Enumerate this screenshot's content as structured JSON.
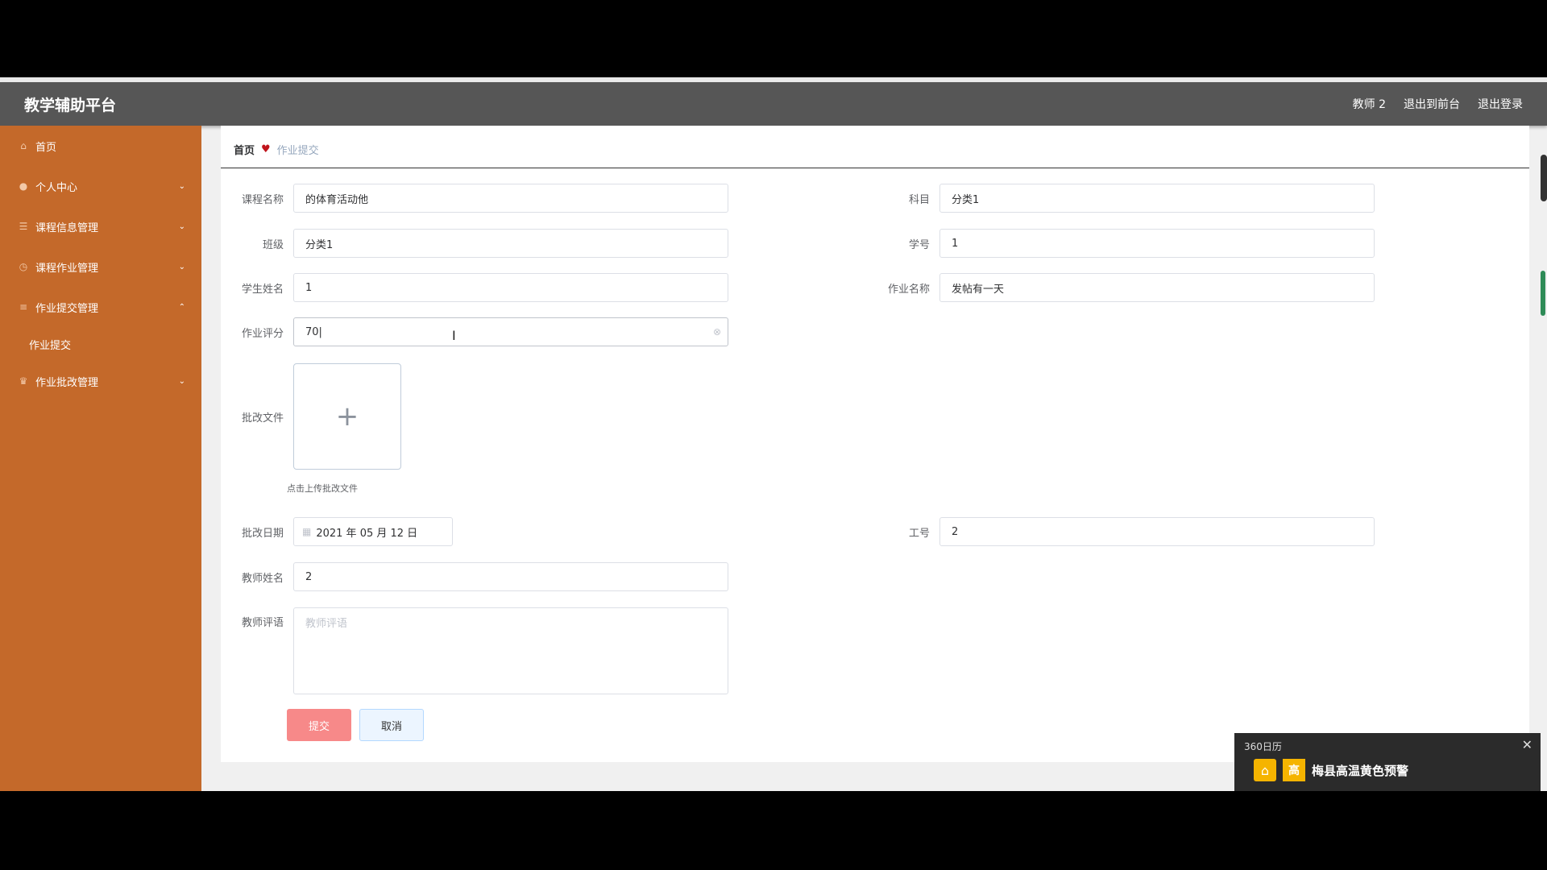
{
  "header": {
    "app_title": "教学辅助平台",
    "user": "教师 2",
    "back_frontend": "退出到前台",
    "logout": "退出登录"
  },
  "sidebar": {
    "items": [
      {
        "label": "首页",
        "icon": "home-icon"
      },
      {
        "label": "个人中心",
        "icon": "user-icon"
      },
      {
        "label": "课程信息管理",
        "icon": "list-icon"
      },
      {
        "label": "课程作业管理",
        "icon": "clock-icon"
      },
      {
        "label": "作业提交管理",
        "icon": "menu-icon"
      },
      {
        "label": "作业批改管理",
        "icon": "trophy-icon"
      }
    ],
    "sub_item": "作业提交"
  },
  "breadcrumb": {
    "home": "首页",
    "current": "作业提交"
  },
  "form": {
    "course_name": {
      "label": "课程名称",
      "value": "的体育活动他"
    },
    "subject": {
      "label": "科目",
      "value": "分类1"
    },
    "class": {
      "label": "班级",
      "value": "分类1"
    },
    "student_id": {
      "label": "学号",
      "value": "1"
    },
    "student_name": {
      "label": "学生姓名",
      "value": "1"
    },
    "homework_name": {
      "label": "作业名称",
      "value": "发帖有一天"
    },
    "score": {
      "label": "作业评分",
      "value": "70|"
    },
    "file": {
      "label": "批改文件",
      "tip": "点击上传批改文件"
    },
    "date": {
      "label": "批改日期",
      "value": "2021 年 05 月 12 日"
    },
    "work_id": {
      "label": "工号",
      "value": "2"
    },
    "teacher_name": {
      "label": "教师姓名",
      "value": "2"
    },
    "comment": {
      "label": "教师评语",
      "placeholder": "教师评语"
    }
  },
  "buttons": {
    "submit": "提交",
    "cancel": "取消"
  },
  "popup": {
    "app": "360日历",
    "badge": "高",
    "title": "梅县高温黄色预警"
  },
  "colors": {
    "sidebar": "#c4692a",
    "topbar": "#565656",
    "submit": "#f78989",
    "heart": "#c0141c"
  }
}
